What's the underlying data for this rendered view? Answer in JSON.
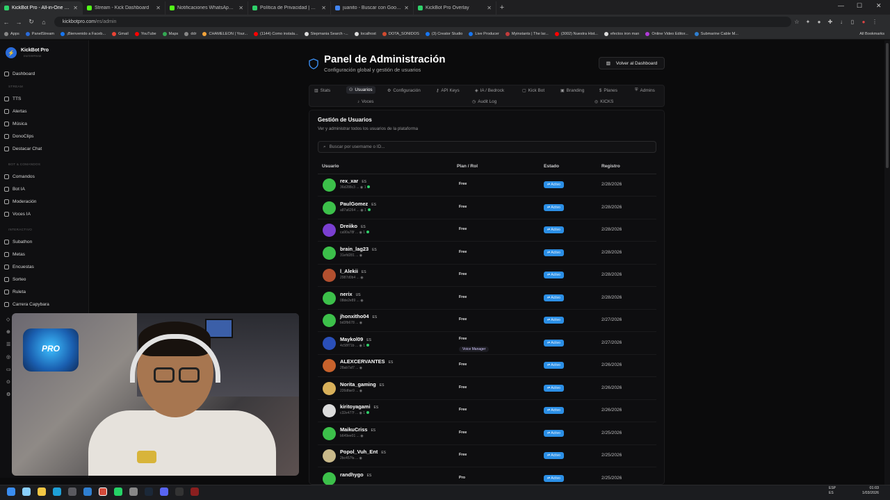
{
  "browser": {
    "tabs": [
      {
        "title": "KickBot Pro - All-in-One Stream",
        "color": "#2fd16a",
        "active": true
      },
      {
        "title": "Stream - Kick Dashboard",
        "color": "#53fc18",
        "active": false
      },
      {
        "title": "Notificaciones WhatsApp - Kick",
        "color": "#53fc18",
        "active": false
      },
      {
        "title": "Política de Privacidad | KickBot",
        "color": "#2fd16a",
        "active": false
      },
      {
        "title": "juanito - Buscar con Google",
        "color": "#4285f4",
        "active": false
      },
      {
        "title": "KickBot Pro Overlay",
        "color": "#2fd16a",
        "active": false
      }
    ],
    "url_host": "kickbotpro.com",
    "url_path": "/es/admin",
    "bookmarks": [
      {
        "label": "Apps",
        "color": "#888888"
      },
      {
        "label": "PanelStream",
        "color": "#2a6bd9"
      },
      {
        "label": "¡Bienvenido a Faceb...",
        "color": "#1877f2"
      },
      {
        "label": "Gmail",
        "color": "#ea4335"
      },
      {
        "label": "YouTube",
        "color": "#ff0000"
      },
      {
        "label": "Maps",
        "color": "#34a853"
      },
      {
        "label": "ddr",
        "color": "#888888"
      },
      {
        "label": "CHAMELEON | Your...",
        "color": "#f2a33a"
      },
      {
        "label": "(1144) Como instala...",
        "color": "#ff0000"
      },
      {
        "label": "Stepmania Search -...",
        "color": "#dddddd"
      },
      {
        "label": "localhost",
        "color": "#dddddd"
      },
      {
        "label": "DOTA_SONIDOS",
        "color": "#d14a2f"
      },
      {
        "label": "(3) Creator Studio",
        "color": "#1877f2"
      },
      {
        "label": "Live Producer",
        "color": "#1877f2"
      },
      {
        "label": "Myinstants | The lar...",
        "color": "#c23b3b"
      },
      {
        "label": "(3002) Nuestra Hist...",
        "color": "#ff0000"
      },
      {
        "label": "efectos iron man",
        "color": "#dddddd"
      },
      {
        "label": "Online Video Editor...",
        "color": "#b03ad8"
      },
      {
        "label": "Submarine Cable M...",
        "color": "#2f7fd1"
      }
    ],
    "all_bookmarks": "All Bookmarks"
  },
  "sidebar": {
    "brand": "KickBot Pro",
    "brand_sub": "ENTERPRISE",
    "items": [
      {
        "label": "Dashboard"
      },
      {
        "section": "STREAM"
      },
      {
        "label": "TTS"
      },
      {
        "label": "Alertas"
      },
      {
        "label": "Música"
      },
      {
        "label": "DonoClips"
      },
      {
        "label": "Destacar Chat"
      },
      {
        "section": "BOT & COMANDOS"
      },
      {
        "label": "Comandos"
      },
      {
        "label": "Bot IA"
      },
      {
        "label": "Moderación"
      },
      {
        "label": "Voces IA"
      },
      {
        "section": "INTERACTIVO"
      },
      {
        "label": "Subathon"
      },
      {
        "label": "Metas"
      },
      {
        "label": "Encuestas"
      },
      {
        "label": "Sorteo"
      },
      {
        "label": "Ruleta"
      },
      {
        "label": "Carrera Capybara"
      }
    ]
  },
  "header": {
    "title": "Panel de Administración",
    "subtitle": "Configuración global y gestión de usuarios",
    "back_button": "Volver al Dashboard"
  },
  "admin_tabs": {
    "row1": [
      "Stats",
      "Usuarios",
      "Configuración",
      "API Keys",
      "IA / Bedrock",
      "Kick Bot",
      "Branding",
      "Planes",
      "Admins"
    ],
    "row2": [
      "Voces",
      "Audit Log",
      "KICKS"
    ],
    "selected": "Usuarios"
  },
  "users_section": {
    "title": "Gestión de Usuarios",
    "subtitle": "Ver y administrar todos los usuarios de la plataforma",
    "search_placeholder": "Buscar por username o ID...",
    "columns": [
      "Usuario",
      "Plan / Rol",
      "Estado",
      "Registro"
    ],
    "rows": [
      {
        "name": "rex_xar",
        "lang": "ES",
        "id": "36d288c3 ...",
        "count": "1",
        "plan": "Free",
        "status": "Activo",
        "date": "2/28/2026",
        "avatar": "#3cc04a"
      },
      {
        "name": "PaulGomez",
        "lang": "ES",
        "id": "a87a6264 ...",
        "count": "1",
        "plan": "Free",
        "status": "Activo",
        "date": "2/28/2026",
        "avatar": "#3cc04a"
      },
      {
        "name": "Dreiiko",
        "lang": "ES",
        "id": "ca90a78f ...",
        "count": "1",
        "plan": "Free",
        "status": "Activo",
        "date": "2/28/2026",
        "avatar": "#7a3fd1"
      },
      {
        "name": "brain_lag23",
        "lang": "ES",
        "id": "31efd281 ...",
        "count": "",
        "plan": "Free",
        "status": "Activo",
        "date": "2/28/2026",
        "avatar": "#3cc04a"
      },
      {
        "name": "l_Alekii",
        "lang": "ES",
        "id": "2987d0b4 ...",
        "count": "",
        "plan": "Free",
        "status": "Activo",
        "date": "2/28/2026",
        "avatar": "#b2502f"
      },
      {
        "name": "nerix",
        "lang": "US",
        "id": "08de2e89 ...",
        "count": "",
        "plan": "Free",
        "status": "Activo",
        "date": "2/28/2026",
        "avatar": "#3cc04a"
      },
      {
        "name": "jhonxitho04",
        "lang": "ES",
        "id": "bd3fb678 ...",
        "count": "",
        "plan": "Free",
        "status": "Activo",
        "date": "2/27/2026",
        "avatar": "#3cc04a"
      },
      {
        "name": "Maykol09",
        "lang": "ES",
        "id": "4c58f71b ...",
        "count": "1",
        "plan": "Free",
        "role": "Voice Manager",
        "status": "Activo",
        "date": "2/27/2026",
        "avatar": "#2a4fb8"
      },
      {
        "name": "ALEXCERVANTES",
        "lang": "ES",
        "id": "28ab7af7 ...",
        "count": "",
        "plan": "Free",
        "status": "Activo",
        "date": "2/26/2026",
        "avatar": "#c7622c"
      },
      {
        "name": "Norita_gaming",
        "lang": "ES",
        "id": "226dfae9 ...",
        "count": "",
        "plan": "Free",
        "status": "Activo",
        "date": "2/26/2026",
        "avatar": "#d8b05a"
      },
      {
        "name": "kiritoyagami",
        "lang": "ES",
        "id": "c32e477f ...",
        "count": "1",
        "plan": "Free",
        "status": "Activo",
        "date": "2/26/2026",
        "avatar": "#dcdcdc"
      },
      {
        "name": "MaikuCriss",
        "lang": "ES",
        "id": "b649ee01 ...",
        "count": "",
        "plan": "Free",
        "status": "Activo",
        "date": "2/25/2026",
        "avatar": "#3cc04a"
      },
      {
        "name": "Popol_Vuh_Ent",
        "lang": "ES",
        "id": "2bc457fa ...",
        "count": "",
        "plan": "Free",
        "status": "Activo",
        "date": "2/25/2026",
        "avatar": "#c9b98a"
      },
      {
        "name": "randhygo",
        "lang": "ES",
        "id": "",
        "count": "",
        "plan": "Pro",
        "status": "Activo",
        "date": "2/25/2026",
        "avatar": "#3cc04a"
      }
    ]
  },
  "webcam": {
    "logo_text": "PRO"
  },
  "taskbar": {
    "lang": "ESP\nES",
    "clock": "01:03\n1/03/2026"
  },
  "colors": {
    "accent": "#2b8fe6",
    "background": "#0b0b0c",
    "online": "#2fd16a"
  }
}
